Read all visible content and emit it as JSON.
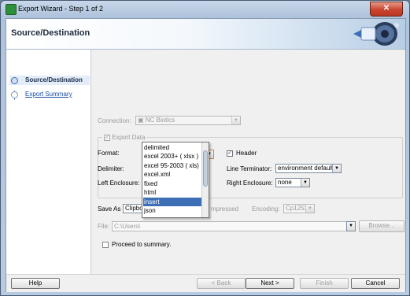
{
  "window": {
    "title": "Export Wizard - Step 1 of 2",
    "close_glyph": "✕"
  },
  "header": {
    "title": "Source/Destination"
  },
  "steps": [
    {
      "label": "Source/Destination"
    },
    {
      "label": "Export Summary"
    }
  ],
  "connection": {
    "label": "Connection:",
    "value": "NC Biotics"
  },
  "export_data": {
    "label": "Export Data",
    "checked": true
  },
  "format": {
    "label": "Format:",
    "value": "delimited",
    "options": [
      "delimited",
      "excel 2003+ ( xlsx )",
      "excel 95-2003 ( xls)",
      "excel.xml",
      "fixed",
      "html",
      "insert",
      "json"
    ],
    "selected": "insert"
  },
  "header_opt": {
    "label": "Header",
    "checked": true
  },
  "delimiter": {
    "label": "Delimiter:"
  },
  "line_terminator": {
    "label": "Line Terminator:",
    "value": "environment default"
  },
  "left_enclosure": {
    "label": "Left Enclosure:"
  },
  "right_enclosure": {
    "label": "Right Enclosure:",
    "value": "none"
  },
  "save_as": {
    "label": "Save As",
    "value": "Clipboa",
    "compressed": "mpressed",
    "encoding_label": "Encoding:",
    "encoding_value": "Cp1252"
  },
  "file": {
    "label": "File:",
    "value": "C:\\Users\\",
    "browse": "Browse..."
  },
  "proceed": {
    "label": "Proceed to summary."
  },
  "buttons": {
    "help": "Help",
    "back": "< Back",
    "next": "Next >",
    "finish": "Finish",
    "cancel": "Cancel"
  },
  "colors": {
    "selection": "#3d6fb6",
    "link": "#1b4ea3"
  }
}
